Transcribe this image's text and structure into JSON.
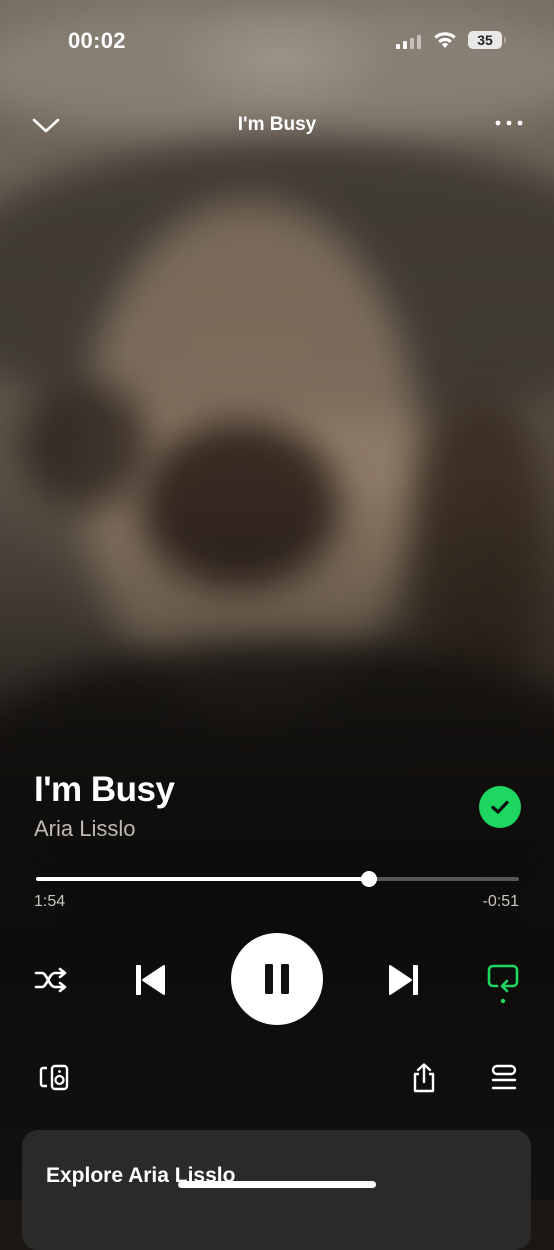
{
  "status_bar": {
    "time": "00:02",
    "battery": "35"
  },
  "header": {
    "title": "I'm Busy"
  },
  "track": {
    "title": "I'm Busy",
    "artist": "Aria Lisslo",
    "liked": true
  },
  "playback": {
    "elapsed": "1:54",
    "remaining": "-0:51",
    "progress": 0.69,
    "state": "playing"
  },
  "controls": {
    "shuffle_icon": "shuffle-icon",
    "previous_icon": "skip-previous-icon",
    "pause_icon": "pause-icon",
    "next_icon": "skip-next-icon",
    "repeat_icon": "repeat-icon",
    "devices_icon": "connect-device-icon",
    "share_icon": "share-icon",
    "queue_icon": "queue-icon"
  },
  "explore": {
    "title": "Explore Aria Lisslo"
  },
  "colors": {
    "accent": "#1ed760",
    "card": "#2b2a28"
  }
}
